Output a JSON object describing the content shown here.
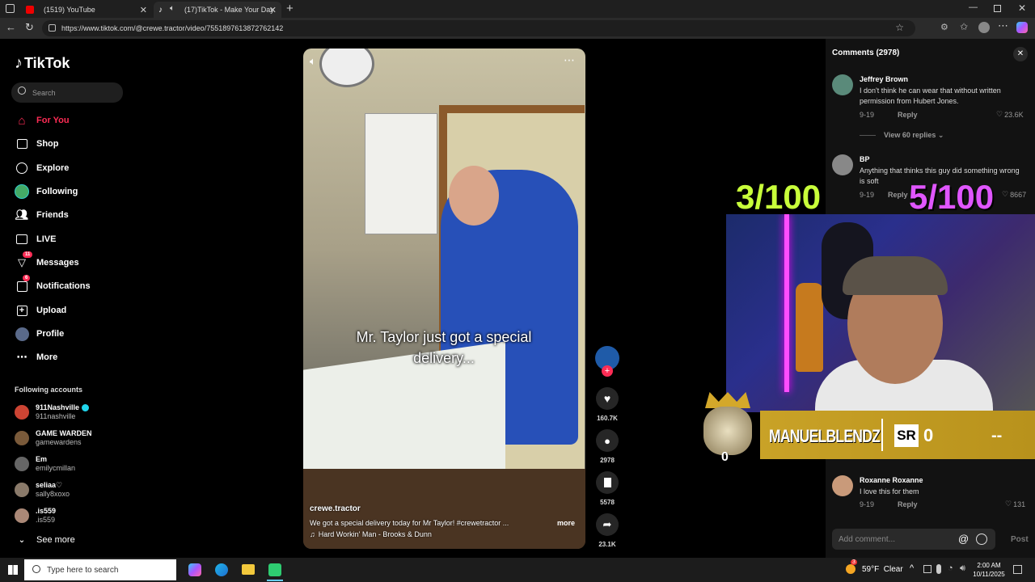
{
  "browser": {
    "tabs": [
      {
        "label": "(1519) YouTube",
        "active": false
      },
      {
        "label": "(17)TikTok - Make Your Day",
        "active": true
      }
    ],
    "url": "https://www.tiktok.com/@crewe.tractor/video/7551897613872762142"
  },
  "sidebar": {
    "logo": "TikTok",
    "search_placeholder": "Search",
    "nav": [
      {
        "label": "For You",
        "icon": "home-icon",
        "active": true
      },
      {
        "label": "Shop",
        "icon": "shop-icon"
      },
      {
        "label": "Explore",
        "icon": "compass-icon"
      },
      {
        "label": "Following",
        "icon": "following-avatar-icon"
      },
      {
        "label": "Friends",
        "icon": "friends-icon"
      },
      {
        "label": "LIVE",
        "icon": "live-icon"
      },
      {
        "label": "Messages",
        "icon": "messages-icon",
        "badge": "11"
      },
      {
        "label": "Notifications",
        "icon": "notifications-icon",
        "badge": "6"
      },
      {
        "label": "Upload",
        "icon": "upload-icon"
      },
      {
        "label": "Profile",
        "icon": "profile-icon"
      },
      {
        "label": "More",
        "icon": "more-icon"
      }
    ],
    "following_title": "Following accounts",
    "accounts": [
      {
        "name": "911Nashville",
        "handle": "911nashville",
        "verified": true
      },
      {
        "name": "GAME WARDEN",
        "handle": "gamewardens"
      },
      {
        "name": "Em",
        "handle": "emilycmillan"
      },
      {
        "name": "seliaa♡",
        "handle": "sally8xoxo"
      },
      {
        "name": ".is559",
        "handle": ".is559"
      }
    ],
    "see_more": "See more"
  },
  "video": {
    "caption_overlay": "Mr. Taylor just got a special delivery...",
    "author": "crewe.tractor",
    "description": "We got a special delivery today for Mr Taylor! #crewetractor ...",
    "more_label": "more",
    "music": "Hard Workin' Man - Brooks & Dunn",
    "likes": "160.7K",
    "comments": "2978",
    "saves": "5578",
    "shares": "23.1K"
  },
  "comments": {
    "title": "Comments (2978)",
    "items": [
      {
        "user": "Jeffrey Brown",
        "text": "I don't think he can wear that without written permission from Hubert Jones.",
        "date": "9-19",
        "reply": "Reply",
        "likes": "23.6K",
        "replies": "View 60 replies"
      },
      {
        "user": "BP",
        "text": "Anything that thinks this guy did something wrong is soft",
        "date": "9-19",
        "reply": "Reply",
        "likes": "8667"
      },
      {
        "user": "Roxanne Roxanne",
        "text": "I love this for them",
        "date": "9-19",
        "reply": "Reply",
        "likes": "131"
      }
    ],
    "add_placeholder": "Add comment...",
    "post_label": "Post"
  },
  "stream_overlay": {
    "counter_left": "3/100",
    "counter_right": "5/100",
    "streamer_name": "MANUELBLENDZ",
    "sr_label": "SR",
    "sr_value": "0",
    "rank_value": "0",
    "dash_value": "--"
  },
  "taskbar": {
    "search_placeholder": "Type here to search",
    "weather": "59°F  Clear",
    "weather_badge": "3",
    "time": "2:00 AM",
    "date": "10/11/2025"
  },
  "colors": {
    "accent": "#fe2c55",
    "banner": "#c9a227",
    "counter": "#c8ff3a",
    "counter_right": "#e056ff"
  }
}
